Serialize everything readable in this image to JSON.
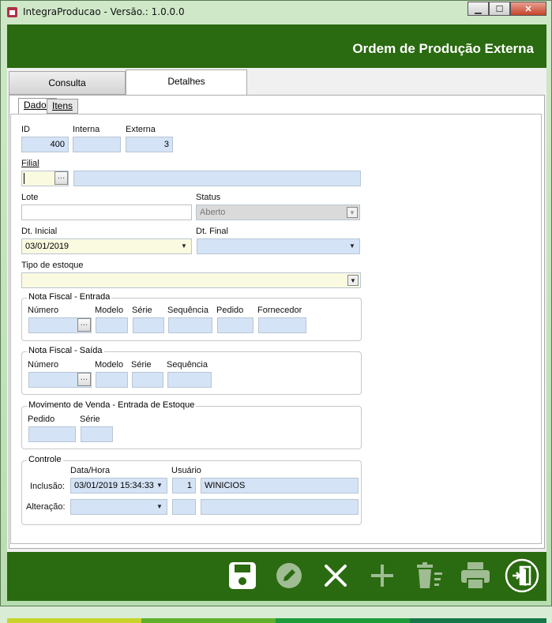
{
  "window": {
    "title": "IntegraProducao - Versão.: 1.0.0.0"
  },
  "header": {
    "title": "Ordem de Produção Externa"
  },
  "tabs": [
    {
      "label": "Consulta"
    },
    {
      "label": "Detalhes"
    }
  ],
  "subtabs": [
    {
      "label": "Dados"
    },
    {
      "label": "Itens"
    }
  ],
  "fields": {
    "id": {
      "label": "ID",
      "value": "400"
    },
    "interna": {
      "label": "Interna",
      "value": ""
    },
    "externa": {
      "label": "Externa",
      "value": "3"
    },
    "filial": {
      "label": "Filial",
      "code": "",
      "name": ""
    },
    "lote": {
      "label": "Lote",
      "value": ""
    },
    "status": {
      "label": "Status",
      "value": "Aberto"
    },
    "dt_inicial": {
      "label": "Dt. Inicial",
      "value": "03/01/2019"
    },
    "dt_final": {
      "label": "Dt. Final",
      "value": ""
    },
    "tipo_estoque": {
      "label": "Tipo de estoque",
      "value": ""
    }
  },
  "nf_entrada": {
    "title": "Nota Fiscal - Entrada",
    "labels": {
      "numero": "Número",
      "modelo": "Modelo",
      "serie": "Série",
      "sequencia": "Sequência",
      "pedido": "Pedido",
      "fornecedor": "Fornecedor"
    }
  },
  "nf_saida": {
    "title": "Nota Fiscal - Saída",
    "labels": {
      "numero": "Número",
      "modelo": "Modelo",
      "serie": "Série",
      "sequencia": "Sequência"
    }
  },
  "mov_venda": {
    "title": "Movimento de Venda - Entrada de Estoque",
    "labels": {
      "pedido": "Pedido",
      "serie": "Série"
    }
  },
  "controle": {
    "title": "Controle",
    "col_datahora": "Data/Hora",
    "col_usuario": "Usuário",
    "inclusao": {
      "label": "Inclusão:",
      "datahora": "03/01/2019 15:34:33",
      "user_id": "1",
      "user_name": "WINICIOS"
    },
    "alteracao": {
      "label": "Alteração:",
      "datahora": "",
      "user_id": "",
      "user_name": ""
    }
  },
  "toolbar": {
    "icons": [
      "save-icon",
      "edit-icon",
      "cancel-icon",
      "add-icon",
      "delete-icon",
      "print-icon",
      "exit-icon"
    ]
  },
  "colors": {
    "header": "#2a6a10",
    "field_blue": "#d4e3f5",
    "field_yellow": "#fafae0"
  }
}
